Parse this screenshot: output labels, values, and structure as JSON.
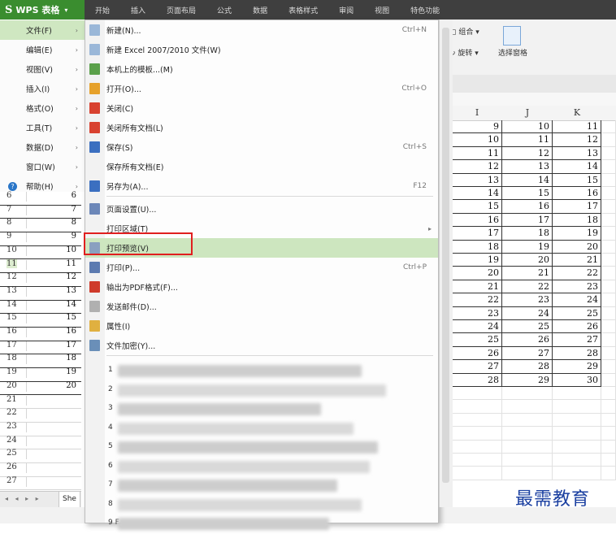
{
  "app": {
    "logo_s": "S",
    "logo_text": "WPS 表格",
    "logo_arrow": "▾"
  },
  "menu_tabs": [
    "开始",
    "插入",
    "页面布局",
    "公式",
    "数据",
    "表格样式",
    "审阅",
    "视图",
    "特色功能"
  ],
  "ribbon": {
    "group_label": "组合",
    "rotate_label": "旋转",
    "select_pane": "选择窗格"
  },
  "left_menu": [
    {
      "label": "文件(F)",
      "active": true
    },
    {
      "label": "编辑(E)"
    },
    {
      "label": "视图(V)"
    },
    {
      "label": "插入(I)"
    },
    {
      "label": "格式(O)"
    },
    {
      "label": "工具(T)"
    },
    {
      "label": "数据(D)"
    },
    {
      "label": "窗口(W)"
    },
    {
      "label": "帮助(H)"
    }
  ],
  "file_menu": [
    {
      "label": "新建(N)...",
      "shortcut": "Ctrl+N",
      "icon": "new-doc-icon"
    },
    {
      "label": "新建 Excel 2007/2010 文件(W)",
      "shortcut": "",
      "icon": "new-excel-icon"
    },
    {
      "label": "本机上的模板...(M)",
      "shortcut": "",
      "icon": "template-icon"
    },
    {
      "label": "打开(O)...",
      "shortcut": "Ctrl+O",
      "icon": "open-folder-icon"
    },
    {
      "label": "关闭(C)",
      "shortcut": "",
      "icon": "close-doc-icon"
    },
    {
      "label": "关闭所有文档(L)",
      "shortcut": "",
      "icon": "close-all-icon"
    },
    {
      "label": "保存(S)",
      "shortcut": "Ctrl+S",
      "icon": "save-icon"
    },
    {
      "label": "保存所有文档(E)",
      "shortcut": "",
      "icon": ""
    },
    {
      "label": "另存为(A)...",
      "shortcut": "F12",
      "icon": "save-as-icon"
    },
    {
      "label": "页面设置(U)...",
      "shortcut": "",
      "icon": "page-setup-icon"
    },
    {
      "label": "打印区域(T)",
      "shortcut": "",
      "icon": "",
      "submenu": "▸"
    },
    {
      "label": "打印预览(V)",
      "shortcut": "",
      "icon": "print-preview-icon",
      "highlighted": true
    },
    {
      "label": "打印(P)...",
      "shortcut": "Ctrl+P",
      "icon": "printer-icon"
    },
    {
      "label": "输出为PDF格式(F)...",
      "shortcut": "",
      "icon": "pdf-icon"
    },
    {
      "label": "发送邮件(D)...",
      "shortcut": "",
      "icon": "mail-icon"
    },
    {
      "label": "属性(I)",
      "shortcut": "",
      "icon": "properties-icon"
    },
    {
      "label": "文件加密(Y)...",
      "shortcut": "",
      "icon": "encrypt-icon"
    }
  ],
  "recent_files": [
    "1",
    "2",
    "3",
    "4",
    "5",
    "6",
    "7",
    "8",
    "9 F"
  ],
  "row_rows": [
    {
      "num": "6",
      "val": "6"
    },
    {
      "num": "7",
      "val": "7"
    },
    {
      "num": "8",
      "val": "8"
    },
    {
      "num": "9",
      "val": "9"
    },
    {
      "num": "10",
      "val": "10"
    },
    {
      "num": "11",
      "val": "11",
      "selected": true
    },
    {
      "num": "12",
      "val": "12"
    },
    {
      "num": "13",
      "val": "13"
    },
    {
      "num": "14",
      "val": "14"
    },
    {
      "num": "15",
      "val": "15"
    },
    {
      "num": "16",
      "val": "16"
    },
    {
      "num": "17",
      "val": "17"
    },
    {
      "num": "18",
      "val": "18"
    },
    {
      "num": "19",
      "val": "19"
    },
    {
      "num": "20",
      "val": "20"
    },
    {
      "num": "21",
      "val": ""
    },
    {
      "num": "22",
      "val": ""
    },
    {
      "num": "23",
      "val": ""
    },
    {
      "num": "24",
      "val": ""
    },
    {
      "num": "25",
      "val": ""
    },
    {
      "num": "26",
      "val": ""
    },
    {
      "num": "27",
      "val": ""
    }
  ],
  "grid": {
    "col_headers": [
      "I",
      "J",
      "K"
    ],
    "rows": [
      [
        "9",
        "10",
        "11"
      ],
      [
        "10",
        "11",
        "12"
      ],
      [
        "11",
        "12",
        "13"
      ],
      [
        "12",
        "13",
        "14"
      ],
      [
        "13",
        "14",
        "15"
      ],
      [
        "14",
        "15",
        "16"
      ],
      [
        "15",
        "16",
        "17"
      ],
      [
        "16",
        "17",
        "18"
      ],
      [
        "17",
        "18",
        "19"
      ],
      [
        "18",
        "19",
        "20"
      ],
      [
        "19",
        "20",
        "21"
      ],
      [
        "20",
        "21",
        "22"
      ],
      [
        "21",
        "22",
        "23"
      ],
      [
        "22",
        "23",
        "24"
      ],
      [
        "23",
        "24",
        "25"
      ],
      [
        "24",
        "25",
        "26"
      ],
      [
        "25",
        "26",
        "27"
      ],
      [
        "26",
        "27",
        "28"
      ],
      [
        "27",
        "28",
        "29"
      ],
      [
        "28",
        "29",
        "30"
      ]
    ]
  },
  "sheet_tab": {
    "nav": "◂ ◂ ▸ ▸",
    "label": "She"
  },
  "watermark": "最需教育",
  "colors": {
    "brand_green": "#3a8d2f",
    "highlight": "#cde6bf",
    "red_box": "#e01f1f"
  }
}
